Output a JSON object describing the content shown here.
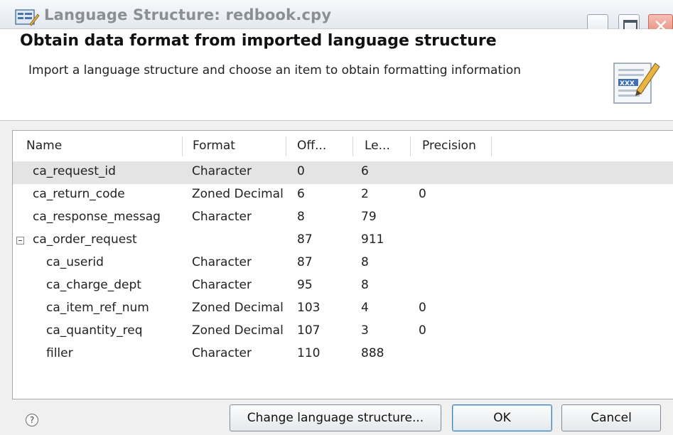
{
  "window": {
    "title": "Language Structure: redbook.cpy"
  },
  "header": {
    "heading": "Obtain data format from imported language structure",
    "subheading": "Import a language structure and choose an item to obtain formatting information"
  },
  "table": {
    "columns": [
      "Name",
      "Format",
      "Off...",
      "Le...",
      "Precision"
    ],
    "rows": [
      {
        "name": "ca_request_id",
        "format": "Character",
        "offset": "0",
        "length": "6",
        "precision": ""
      },
      {
        "name": "ca_return_code",
        "format": "Zoned Decimal",
        "offset": "6",
        "length": "2",
        "precision": "0"
      },
      {
        "name": "ca_response_messag",
        "format": "Character",
        "offset": "8",
        "length": "79",
        "precision": ""
      },
      {
        "name": "ca_order_request",
        "format": "",
        "offset": "87",
        "length": "911",
        "precision": ""
      },
      {
        "name": "ca_userid",
        "format": "Character",
        "offset": "87",
        "length": "8",
        "precision": ""
      },
      {
        "name": "ca_charge_dept",
        "format": "Character",
        "offset": "95",
        "length": "8",
        "precision": ""
      },
      {
        "name": "ca_item_ref_num",
        "format": "Zoned Decimal",
        "offset": "103",
        "length": "4",
        "precision": "0"
      },
      {
        "name": "ca_quantity_req",
        "format": "Zoned Decimal",
        "offset": "107",
        "length": "3",
        "precision": "0"
      },
      {
        "name": "filler",
        "format": "Character",
        "offset": "110",
        "length": "888",
        "precision": ""
      }
    ]
  },
  "buttons": {
    "help": "?",
    "change": "Change language structure...",
    "ok": "OK",
    "cancel": "Cancel"
  },
  "icons": {
    "app": "language-structure-icon",
    "wizard": "edit-document-icon"
  }
}
